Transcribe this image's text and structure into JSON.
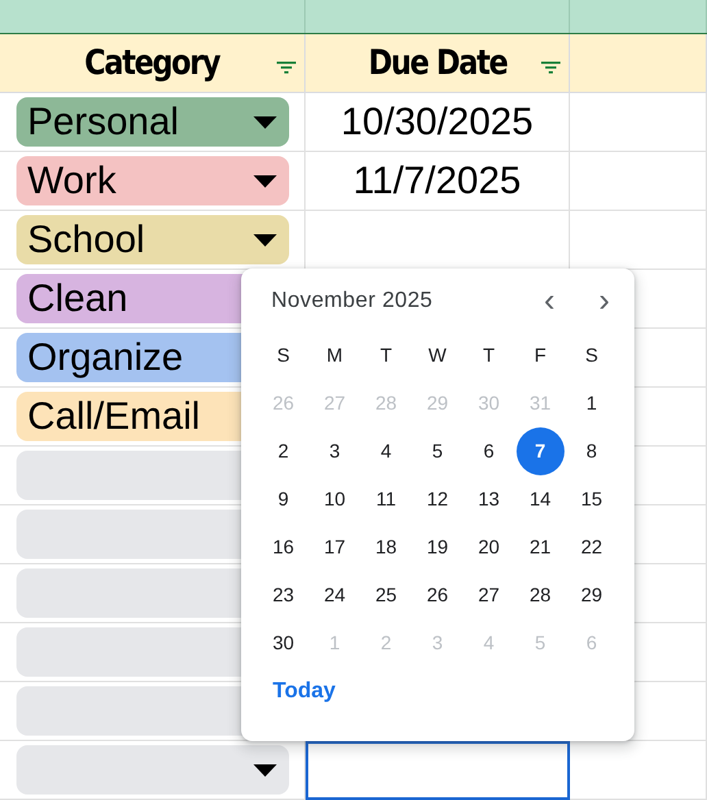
{
  "columns": [
    {
      "label": "Category"
    },
    {
      "label": "Due Date"
    }
  ],
  "rows": [
    {
      "category": "Personal",
      "color": "#8db897",
      "dropdown_arrow": true,
      "due_date": "10/30/2025",
      "due_date_selected": false
    },
    {
      "category": "Work",
      "color": "#f4c2c2",
      "dropdown_arrow": true,
      "due_date": "11/7/2025",
      "due_date_selected": false
    },
    {
      "category": "School",
      "color": "#e9dca8",
      "dropdown_arrow": true,
      "due_date_selected": false
    },
    {
      "category": "Clean",
      "color": "#d7b4e0"
    },
    {
      "category": "Organize",
      "color": "#a4c2f0"
    },
    {
      "category": "Call/Email",
      "color": "#fde3b8"
    },
    {
      "color": "#e6e7ea"
    },
    {
      "color": "#e6e7ea"
    },
    {
      "color": "#e6e7ea"
    },
    {
      "color": "#e6e7ea"
    },
    {
      "color": "#e6e7ea"
    },
    {
      "color": "#e6e7ea",
      "dropdown_arrow": true,
      "due_date_selected": true
    }
  ],
  "date_picker": {
    "month": "November 2025",
    "prev": "‹",
    "next": "›",
    "weekdays": [
      "S",
      "M",
      "T",
      "W",
      "T",
      "F",
      "S"
    ],
    "days": [
      {
        "label": "26",
        "outside_month": true,
        "selected": false
      },
      {
        "label": "27",
        "outside_month": true,
        "selected": false
      },
      {
        "label": "28",
        "outside_month": true,
        "selected": false
      },
      {
        "label": "29",
        "outside_month": true,
        "selected": false
      },
      {
        "label": "30",
        "outside_month": true,
        "selected": false
      },
      {
        "label": "31",
        "outside_month": true,
        "selected": false
      },
      {
        "label": "1",
        "outside_month": false,
        "selected": false
      },
      {
        "label": "2",
        "outside_month": false,
        "selected": false
      },
      {
        "label": "3",
        "outside_month": false,
        "selected": false
      },
      {
        "label": "4",
        "outside_month": false,
        "selected": false
      },
      {
        "label": "5",
        "outside_month": false,
        "selected": false
      },
      {
        "label": "6",
        "outside_month": false,
        "selected": false
      },
      {
        "label": "7",
        "outside_month": false,
        "selected": true
      },
      {
        "label": "8",
        "outside_month": false,
        "selected": false
      },
      {
        "label": "9",
        "outside_month": false,
        "selected": false
      },
      {
        "label": "10",
        "outside_month": false,
        "selected": false
      },
      {
        "label": "11",
        "outside_month": false,
        "selected": false
      },
      {
        "label": "12",
        "outside_month": false,
        "selected": false
      },
      {
        "label": "13",
        "outside_month": false,
        "selected": false
      },
      {
        "label": "14",
        "outside_month": false,
        "selected": false
      },
      {
        "label": "15",
        "outside_month": false,
        "selected": false
      },
      {
        "label": "16",
        "outside_month": false,
        "selected": false
      },
      {
        "label": "17",
        "outside_month": false,
        "selected": false
      },
      {
        "label": "18",
        "outside_month": false,
        "selected": false
      },
      {
        "label": "19",
        "outside_month": false,
        "selected": false
      },
      {
        "label": "20",
        "outside_month": false,
        "selected": false
      },
      {
        "label": "21",
        "outside_month": false,
        "selected": false
      },
      {
        "label": "22",
        "outside_month": false,
        "selected": false
      },
      {
        "label": "23",
        "outside_month": false,
        "selected": false
      },
      {
        "label": "24",
        "outside_month": false,
        "selected": false
      },
      {
        "label": "25",
        "outside_month": false,
        "selected": false
      },
      {
        "label": "26",
        "outside_month": false,
        "selected": false
      },
      {
        "label": "27",
        "outside_month": false,
        "selected": false
      },
      {
        "label": "28",
        "outside_month": false,
        "selected": false
      },
      {
        "label": "29",
        "outside_month": false,
        "selected": false
      },
      {
        "label": "30",
        "outside_month": false,
        "selected": false
      },
      {
        "label": "1",
        "outside_month": true,
        "selected": false
      },
      {
        "label": "2",
        "outside_month": true,
        "selected": false
      },
      {
        "label": "3",
        "outside_month": true,
        "selected": false
      },
      {
        "label": "4",
        "outside_month": true,
        "selected": false
      },
      {
        "label": "5",
        "outside_month": true,
        "selected": false
      },
      {
        "label": "6",
        "outside_month": true,
        "selected": false
      }
    ],
    "today_button": "Today"
  }
}
